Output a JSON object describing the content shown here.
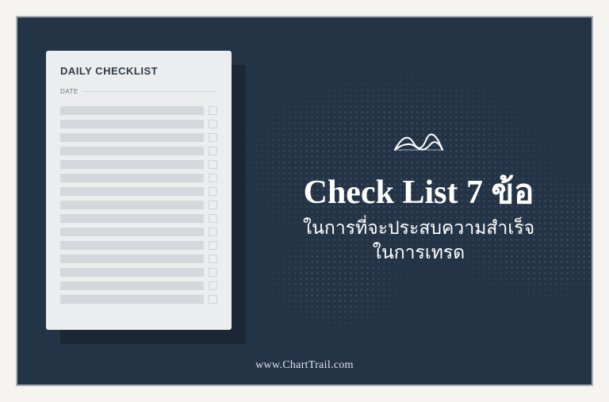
{
  "checklist": {
    "title": "DAILY CHECKLIST",
    "date_label": "DATE",
    "row_count": 15
  },
  "headline": {
    "title": "Check List 7 ข้อ",
    "subtitle_line1": "ในการที่จะประสบความสำเร็จ",
    "subtitle_line2": "ในการเทรด"
  },
  "footer": {
    "url": "www.ChartTrail.com"
  },
  "icons": {
    "logo": "chart-wave-icon"
  },
  "colors": {
    "background": "#243447",
    "text": "#ffffff",
    "card": "#ecedee"
  }
}
